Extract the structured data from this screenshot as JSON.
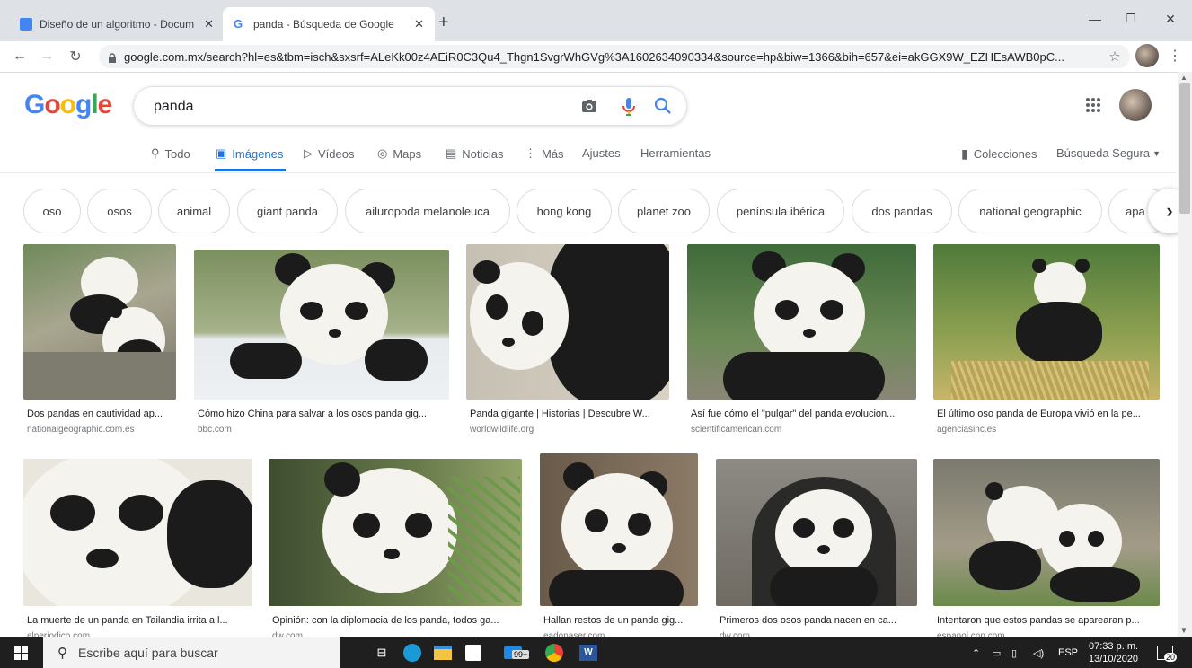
{
  "browser": {
    "tabs": [
      {
        "label": "Diseño de un algoritmo - Docum",
        "favicon": "docs-icon"
      },
      {
        "label": "panda - Búsqueda de Google",
        "favicon": "google-g-icon"
      }
    ],
    "url": "google.com.mx/search?hl=es&tbm=isch&sxsrf=ALeKk00z4AEiR0C3Qu4_Thgn1SvgrWhGVg%3A1602634090334&source=hp&biw=1366&bih=657&ei=akGGX9W_EZHEsAWB0pC..."
  },
  "google": {
    "logo": [
      "G",
      "o",
      "o",
      "g",
      "l",
      "e"
    ],
    "logo_colors": [
      "#4285f4",
      "#ea4335",
      "#fbbc05",
      "#4285f4",
      "#34a853",
      "#ea4335"
    ],
    "query": "panda",
    "nav": [
      {
        "label": "Todo",
        "icon": "search-icon"
      },
      {
        "label": "Imágenes",
        "icon": "image-icon",
        "active": true
      },
      {
        "label": "Vídeos",
        "icon": "play-icon"
      },
      {
        "label": "Maps",
        "icon": "pin-icon"
      },
      {
        "label": "Noticias",
        "icon": "news-icon"
      },
      {
        "label": "Más",
        "icon": "more-dots-icon"
      },
      {
        "label": "Ajustes"
      },
      {
        "label": "Herramientas"
      }
    ],
    "collections": "Colecciones",
    "safe_search": "Búsqueda Segura",
    "chips": [
      "oso",
      "osos",
      "animal",
      "giant panda",
      "ailuropoda melanoleuca",
      "hong kong",
      "planet zoo",
      "península ibérica",
      "dos pandas",
      "national geographic",
      "apa"
    ]
  },
  "results": [
    {
      "title": "Dos pandas en cautividad ap...",
      "source": "nationalgeographic.com.es"
    },
    {
      "title": "Cómo hizo China para salvar a los osos panda gig...",
      "source": "bbc.com"
    },
    {
      "title": "Panda gigante | Historias | Descubre W...",
      "source": "worldwildlife.org"
    },
    {
      "title": "Así fue cómo el \"pulgar\" del panda evolucion...",
      "source": "scientificamerican.com"
    },
    {
      "title": "El último oso panda de Europa vivió en la pe...",
      "source": "agenciasinc.es"
    },
    {
      "title": "La muerte de un panda en Tailandia irrita a l...",
      "source": "elperiodico.com"
    },
    {
      "title": "Opinión: con la diplomacia de los panda, todos ga...",
      "source": "dw.com"
    },
    {
      "title": "Hallan restos de un panda gig...",
      "source": "eadonaser.com"
    },
    {
      "title": "Primeros dos osos panda nacen en ca...",
      "source": "dw.com"
    },
    {
      "title": "Intentaron que estos pandas se aparearan p...",
      "source": "espanol.cnn.com"
    }
  ],
  "taskbar": {
    "search_placeholder": "Escribe aquí para buscar",
    "badge": "99+",
    "lang": "ESP",
    "time": "07:33 p. m.",
    "date": "13/10/2020",
    "notif": "20"
  }
}
